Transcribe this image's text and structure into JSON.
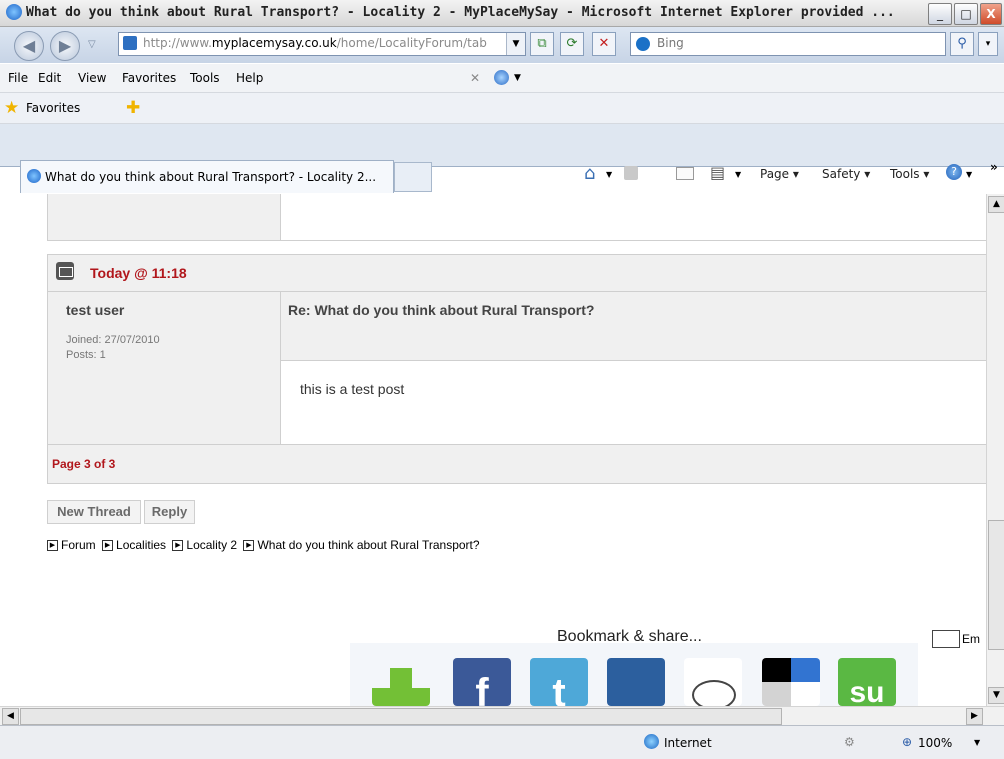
{
  "window": {
    "title": "What do you think about Rural Transport? - Locality 2 - MyPlaceMySay - Microsoft Internet Explorer provided ...",
    "min_label": "_",
    "max_label": "□",
    "close_label": "X"
  },
  "address": {
    "url_prefix": "http://www.",
    "url_domain": "myplacemysay.co.uk",
    "url_path": "/home/LocalityForum/tab",
    "search_placeholder": "Bing"
  },
  "menu": [
    "File",
    "Edit",
    "View",
    "Favorites",
    "Tools",
    "Help"
  ],
  "favorites": {
    "label": "Favorites"
  },
  "tab": {
    "label": "What do you think about Rural Transport? - Locality 2..."
  },
  "commands": {
    "page": "Page ▾",
    "safety": "Safety ▾",
    "tools": "Tools ▾",
    "more": "»"
  },
  "post": {
    "timestamp": "Today @ 11:18",
    "author": "test user",
    "joined": "Joined: 27/07/2010",
    "posts": "Posts: 1",
    "subject": "Re: What do you think about Rural Transport?",
    "body": "this is a test post"
  },
  "pagination": {
    "text": "Page 3 of 3"
  },
  "actions": {
    "new_thread": "New Thread",
    "reply": "Reply"
  },
  "breadcrumb": [
    "Forum",
    "Localities",
    "Locality 2",
    "What do you think about Rural Transport?"
  ],
  "email": {
    "label": "Em"
  },
  "bookmark": {
    "title": "Bookmark & share...",
    "icons": [
      "addthis-icon",
      "facebook-icon",
      "twitter-icon",
      "myspace-icon",
      "reddit-icon",
      "delicious-icon",
      "stumbleupon-icon"
    ]
  },
  "status": {
    "zone": "Internet",
    "zoom": "100%"
  },
  "colors": {
    "accent_red": "#b1161b",
    "cell_gray": "#f0f0f0"
  }
}
